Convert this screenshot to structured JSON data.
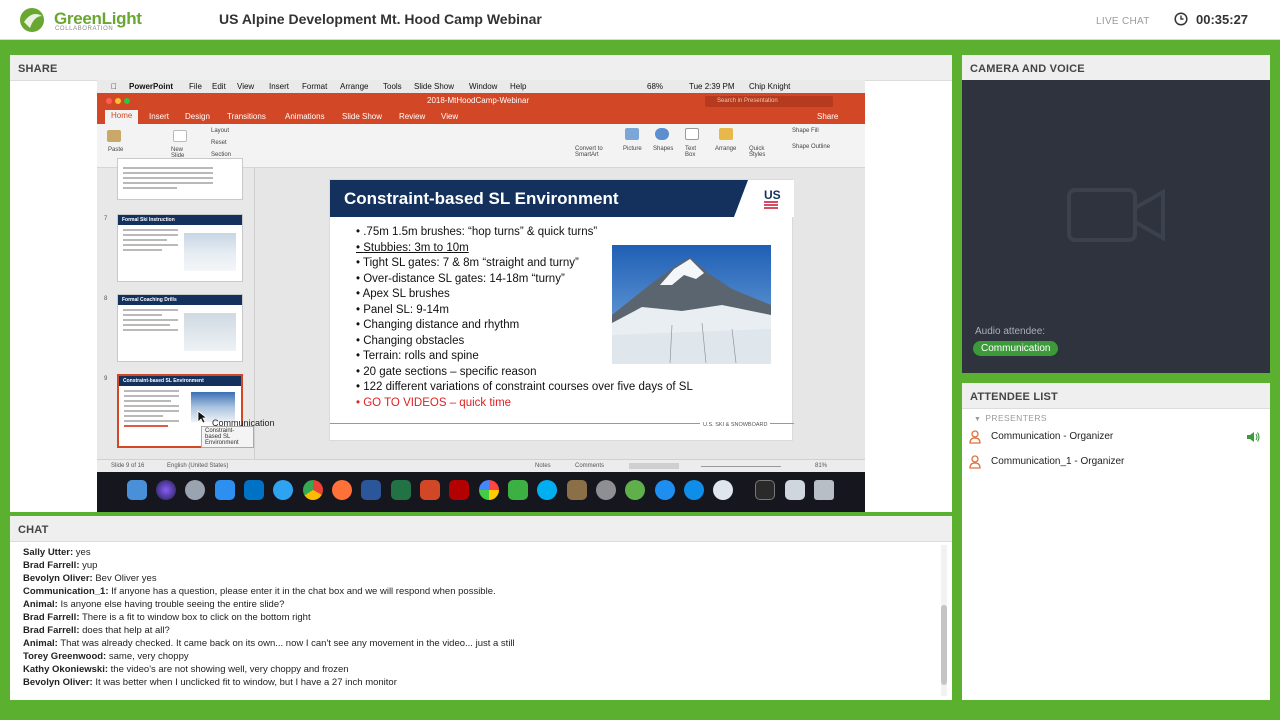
{
  "app": {
    "logo_text": "GreenLight",
    "logo_sub": "COLLABORATION",
    "title": "US Alpine Development Mt. Hood Camp Webinar",
    "live_chat": "LIVE CHAT",
    "timer": "00:35:27"
  },
  "colors": {
    "brand_green": "#5cb030",
    "ppt_orange": "#d24726",
    "slide_navy": "#13315c",
    "badge_green": "#3d9a3a"
  },
  "share": {
    "header": "SHARE",
    "mac_menu": [
      "PowerPoint",
      "File",
      "Edit",
      "View",
      "Insert",
      "Format",
      "Arrange",
      "Tools",
      "Slide Show",
      "Window",
      "Help"
    ],
    "mac_status": [
      "68%",
      "Tue 2:39 PM",
      "Chip Knight"
    ],
    "file_name": "2018-MtHoodCamp-Webinar",
    "search_placeholder": "Search in Presentation",
    "ribbon_tabs": [
      "Home",
      "Insert",
      "Design",
      "Transitions",
      "Animations",
      "Slide Show",
      "Review",
      "View"
    ],
    "share_btn": "Share",
    "ribbon": {
      "paste": "Paste",
      "new_slide": "New Slide",
      "layout": "Layout",
      "reset": "Reset",
      "section": "Section",
      "convert": "Convert to SmartArt",
      "picture": "Picture",
      "shapes": "Shapes",
      "text_box": "Text Box",
      "arrange": "Arrange",
      "quick_styles": "Quick Styles",
      "shape_fill": "Shape Fill",
      "shape_outline": "Shape Outline"
    },
    "thumbnails": [
      {
        "num": "7",
        "title": "Formal Ski Instruction"
      },
      {
        "num": "8",
        "title": "Formal Coaching Drills"
      },
      {
        "num": "9",
        "title": "Constraint-based SL Environment"
      }
    ],
    "tooltip": "Constraint-based SL Environment",
    "cursor_label": "Communication",
    "slide": {
      "title": "Constraint-based SL Environment",
      "logo_text": "US",
      "bullets": [
        ".75m 1.5m brushes: “hop turns” & quick turns”",
        "Stubbies: 3m to 10m",
        "Tight SL gates: 7 & 8m “straight and turny”",
        "Over-distance SL gates: 14-18m “turny”",
        "Apex SL brushes",
        "Panel SL: 9-14m",
        "Changing distance and rhythm",
        "Changing obstacles",
        "Terrain: rolls and spine",
        "20 gate sections – specific reason",
        "122 different variations of constraint courses over five days of SL"
      ],
      "red_bullet": "GO TO VIDEOS – quick time",
      "footer": "U.S. SKI & SNOWBOARD"
    },
    "status": {
      "slide_of": "Slide 9 of 16",
      "language": "English (United States)",
      "notes": "Notes",
      "comments": "Comments",
      "zoom": "81%"
    }
  },
  "chat": {
    "header": "CHAT",
    "messages": [
      {
        "from": "Sally Utter:",
        "text": "yes"
      },
      {
        "from": "Brad Farrell:",
        "text": "yup"
      },
      {
        "from": "Bevolyn Oliver:",
        "text": "Bev Oliver yes"
      },
      {
        "from": "Communication_1:",
        "text": "If anyone has a question, please enter it in the chat box and we will respond when possible."
      },
      {
        "from": "Animal:",
        "text": "Is anyone else having trouble seeing the entire slide?"
      },
      {
        "from": "Brad Farrell:",
        "text": "There is a fit to window box to click on the bottom right"
      },
      {
        "from": "Brad Farrell:",
        "text": "does that help at all?"
      },
      {
        "from": "Animal:",
        "text": "That was already checked.  It came back on its own... now I can't see any movement in the video... just a still"
      },
      {
        "from": "Torey Greenwood:",
        "text": "same, very choppy"
      },
      {
        "from": "Kathy Okoniewski:",
        "text": "the video's are not showing well, very choppy and frozen"
      },
      {
        "from": "Bevolyn Oliver:",
        "text": "It was better when I unclicked fit to window, but I have a 27 inch monitor"
      }
    ]
  },
  "camera": {
    "header": "CAMERA AND VOICE",
    "audio_label": "Audio attendee:",
    "audio_badge": "Communication"
  },
  "attendees": {
    "header": "ATTENDEE LIST",
    "section": "PRESENTERS",
    "list": [
      {
        "name": "Communication  - Organizer",
        "speaking": true
      },
      {
        "name": "Communication_1  - Organizer",
        "speaking": false
      }
    ]
  }
}
